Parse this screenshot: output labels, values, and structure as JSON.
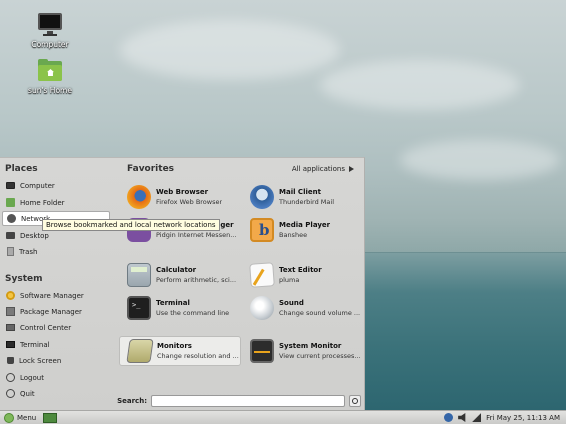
{
  "desktop": {
    "icons": [
      {
        "label": "Computer",
        "icon": "monitor-icon"
      },
      {
        "label": "sun's Home",
        "icon": "home-folder-icon"
      }
    ]
  },
  "menu": {
    "places_title": "Places",
    "places": [
      {
        "label": "Computer",
        "icon": "computer-icon"
      },
      {
        "label": "Home Folder",
        "icon": "home-folder-icon"
      },
      {
        "label": "Network",
        "icon": "network-icon"
      },
      {
        "label": "Desktop",
        "icon": "desktop-icon"
      },
      {
        "label": "Trash",
        "icon": "trash-icon"
      }
    ],
    "system_title": "System",
    "system": [
      {
        "label": "Software Manager",
        "icon": "software-manager-icon"
      },
      {
        "label": "Package Manager",
        "icon": "package-manager-icon"
      },
      {
        "label": "Control Center",
        "icon": "control-center-icon"
      },
      {
        "label": "Terminal",
        "icon": "terminal-icon"
      },
      {
        "label": "Lock Screen",
        "icon": "lock-icon"
      },
      {
        "label": "Logout",
        "icon": "logout-icon"
      },
      {
        "label": "Quit",
        "icon": "quit-icon"
      }
    ],
    "favorites_title": "Favorites",
    "all_applications": "All applications",
    "favorites": [
      {
        "name": "Web Browser",
        "desc": "Firefox Web Browser",
        "icon": "firefox-icon"
      },
      {
        "name": "Mail Client",
        "desc": "Thunderbird Mail",
        "icon": "mail-client-icon"
      },
      {
        "name": "Internet Messenger",
        "desc": "Pidgin Internet Messen...",
        "icon": "pidgin-icon"
      },
      {
        "name": "Media Player",
        "desc": "Banshee",
        "icon": "banshee-icon"
      },
      {
        "name": "Calculator",
        "desc": "Perform arithmetic, sci...",
        "icon": "calculator-icon"
      },
      {
        "name": "Text Editor",
        "desc": "pluma",
        "icon": "text-editor-icon"
      },
      {
        "name": "Terminal",
        "desc": "Use the command line",
        "icon": "terminal-icon"
      },
      {
        "name": "Sound",
        "desc": "Change sound volume ...",
        "icon": "sound-icon"
      },
      {
        "name": "Monitors",
        "desc": "Change resolution and ...",
        "icon": "monitors-icon"
      },
      {
        "name": "System Monitor",
        "desc": "View current processes...",
        "icon": "system-monitor-icon"
      }
    ],
    "search_label": "Search:",
    "search_value": "",
    "tooltip": "Browse bookmarked and local network locations"
  },
  "panel": {
    "menu_label": "Menu",
    "clock": "Fri May 25, 11:13 AM"
  }
}
